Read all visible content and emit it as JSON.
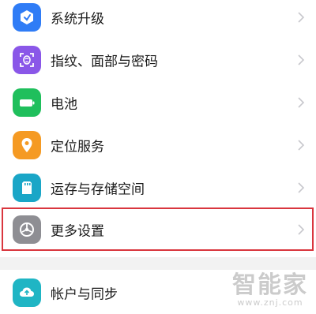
{
  "settings": {
    "items": [
      {
        "label": "系统升级",
        "icon": "system-update-icon",
        "color": "#2f7cf6"
      },
      {
        "label": "指纹、面部与密码",
        "icon": "fingerprint-face-icon",
        "color": "#8a57e8"
      },
      {
        "label": "电池",
        "icon": "battery-icon",
        "color": "#1fbf5c"
      },
      {
        "label": "定位服务",
        "icon": "location-icon",
        "color": "#f59a23"
      },
      {
        "label": "运存与存储空间",
        "icon": "storage-icon",
        "color": "#1aa6c7"
      },
      {
        "label": "更多设置",
        "icon": "more-settings-icon",
        "color": "#8e8e93"
      },
      {
        "label": "帐户与同步",
        "icon": "account-sync-icon",
        "color": "#1fb5c4"
      }
    ]
  },
  "watermark": {
    "main": "智能家",
    "sub": "www.znj.com"
  },
  "colors": {
    "highlight": "#d9363e",
    "chevron": "#c7c7cc"
  }
}
